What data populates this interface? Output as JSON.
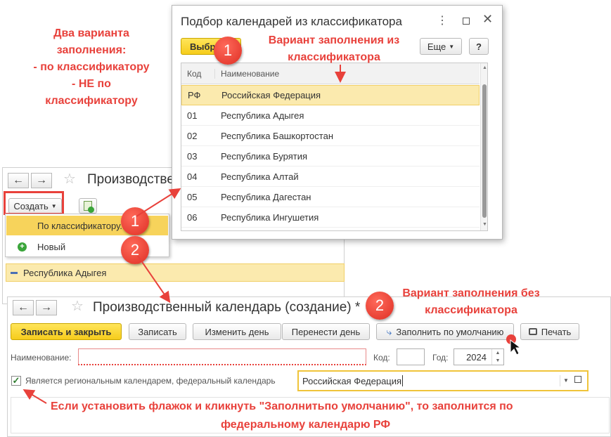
{
  "annotations": {
    "variants_lines": [
      "Два варианта",
      "заполнения:",
      "- по классификатору",
      "- НЕ по",
      "классификатору"
    ],
    "variant1": "Вариант заполнения из классификатора",
    "variant2": "Вариант заполнения без классификатора",
    "bottom_note_line1": "Если установить флажок и кликнуть \"Заполнитьпо умолчанию\", то заполнится по",
    "bottom_note_line2": "федеральному календарю РФ",
    "badge1": "1",
    "badge2": "2"
  },
  "back_window": {
    "title": "Производстве",
    "create_button": "Создать",
    "menu_items": [
      "По классификатору...",
      "Новый"
    ],
    "list_row": "Республика Адыгея"
  },
  "picker": {
    "title": "Подбор календарей из классификатора",
    "select_button": "Выбрать",
    "more_button": "Еще",
    "help_button": "?",
    "columns": [
      "Код",
      "Наименование"
    ],
    "rows": [
      {
        "code": "РФ",
        "name": "Российская Федерация"
      },
      {
        "code": "01",
        "name": "Республика Адыгея"
      },
      {
        "code": "02",
        "name": "Республика Башкортостан"
      },
      {
        "code": "03",
        "name": "Республика Бурятия"
      },
      {
        "code": "04",
        "name": "Республика Алтай"
      },
      {
        "code": "05",
        "name": "Республика Дагестан"
      },
      {
        "code": "06",
        "name": "Республика Ингушетия"
      }
    ]
  },
  "form": {
    "title": "Производственный календарь (создание) *",
    "buttons": {
      "save_close": "Записать и закрыть",
      "save": "Записать",
      "change_day": "Изменить день",
      "move_day": "Перенести день",
      "fill_default": "Заполнить по умолчанию",
      "print": "Печать"
    },
    "name_label": "Наименование:",
    "name_value": "",
    "code_label": "Код:",
    "code_value": "",
    "year_label": "Год:",
    "year_value": "2024",
    "checkbox_label": "Является региональным календарем, федеральный календарь",
    "checkbox_checked": true,
    "federal_value": "Российская Федерация"
  },
  "colors": {
    "accent_red": "#e8413b",
    "selection_yellow": "#f7d35b"
  }
}
